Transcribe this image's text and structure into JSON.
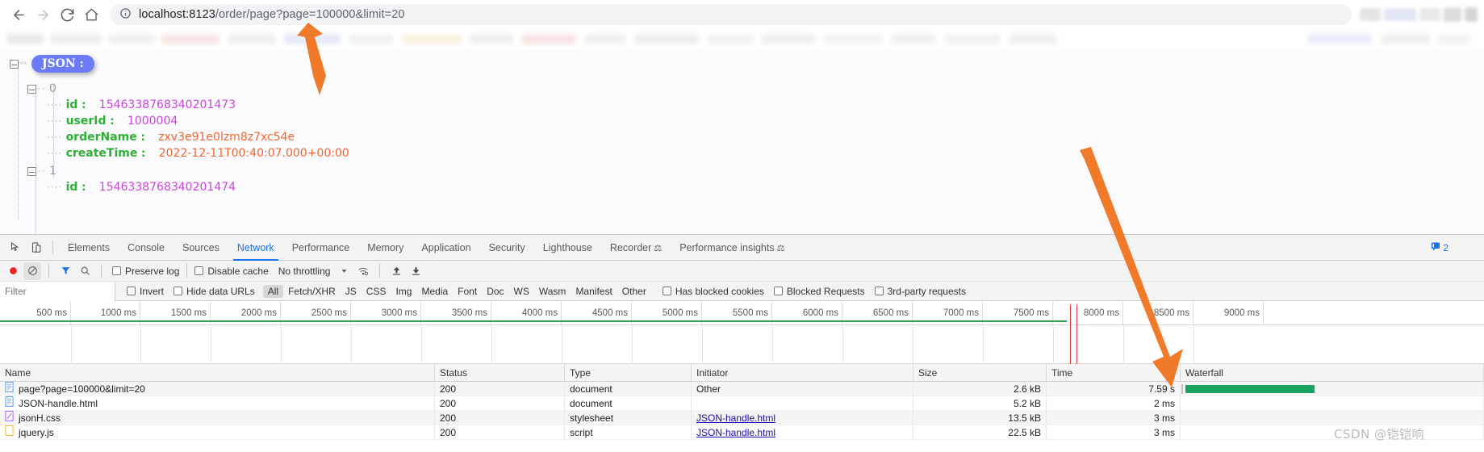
{
  "browser": {
    "back_label": "Back",
    "forward_label": "Forward",
    "reload_label": "Reload",
    "home_label": "Home",
    "site_info_icon": "info-circle-icon",
    "url_host": "localhost:8123",
    "url_path": "/order/page?page=100000&limit=20",
    "url_full": "localhost:8123/order/page?page=100000&limit=20"
  },
  "json_viewer": {
    "root_label": "JSON :",
    "nodes": [
      {
        "index": "0",
        "fields": [
          {
            "key": "id",
            "value": "1546338768340201473",
            "vtype": "num"
          },
          {
            "key": "userId",
            "value": "1000004",
            "vtype": "num"
          },
          {
            "key": "orderName",
            "value": "zxv3e91e0lzm8z7xc54e",
            "vtype": "str"
          },
          {
            "key": "createTime",
            "value": "2022-12-11T00:40:07.000+00:00",
            "vtype": "str"
          }
        ]
      },
      {
        "index": "1",
        "fields": [
          {
            "key": "id",
            "value": "1546338768340201474",
            "vtype": "num"
          }
        ]
      }
    ],
    "colors": {
      "key": "#2faf35",
      "number": "#cc44dd",
      "string": "#ef6632",
      "badge": "#6c7bf7"
    }
  },
  "devtools": {
    "tabs": [
      {
        "label": "Elements",
        "active": false
      },
      {
        "label": "Console",
        "active": false
      },
      {
        "label": "Sources",
        "active": false
      },
      {
        "label": "Network",
        "active": true
      },
      {
        "label": "Performance",
        "active": false
      },
      {
        "label": "Memory",
        "active": false
      },
      {
        "label": "Application",
        "active": false
      },
      {
        "label": "Security",
        "active": false
      },
      {
        "label": "Lighthouse",
        "active": false
      },
      {
        "label": "Recorder",
        "active": false,
        "beaker": true
      },
      {
        "label": "Performance insights",
        "active": false,
        "beaker": true
      }
    ],
    "inspect_icon": "inspect-element-icon",
    "device_icon": "device-toolbar-icon",
    "messages_count": "2",
    "messages_icon": "message-icon",
    "toolbar": {
      "record_icon": "record-stop-icon",
      "clear_icon": "clear-icon",
      "filter_icon": "filter-funnel-icon",
      "search_icon": "search-icon",
      "preserve_log": "Preserve log",
      "disable_cache": "Disable cache",
      "throttling": "No throttling",
      "throttle_caret_icon": "chevron-down-icon",
      "network_conditions_icon": "wifi-settings-icon",
      "import_icon": "import-har-icon",
      "export_icon": "export-har-icon"
    },
    "filterbar": {
      "filter_placeholder": "Filter",
      "filter_value": "",
      "invert": "Invert",
      "hide_data_urls": "Hide data URLs",
      "types": [
        "All",
        "Fetch/XHR",
        "JS",
        "CSS",
        "Img",
        "Media",
        "Font",
        "Doc",
        "WS",
        "Wasm",
        "Manifest",
        "Other"
      ],
      "active_type": "All",
      "has_blocked_cookies": "Has blocked cookies",
      "blocked_requests": "Blocked Requests",
      "third_party_requests": "3rd-party requests"
    },
    "overview_ticks": [
      "500 ms",
      "1000 ms",
      "1500 ms",
      "2000 ms",
      "2500 ms",
      "3000 ms",
      "3500 ms",
      "4000 ms",
      "4500 ms",
      "5000 ms",
      "5500 ms",
      "6000 ms",
      "6500 ms",
      "7000 ms",
      "7500 ms",
      "8000 ms",
      "8500 ms",
      "9000 ms"
    ],
    "table": {
      "columns": [
        "Name",
        "Status",
        "Type",
        "Initiator",
        "Size",
        "Time",
        "Waterfall"
      ],
      "rows": [
        {
          "icon": "document-file-icon",
          "name": "page?page=100000&limit=20",
          "status": "200",
          "type": "document",
          "initiator": "Other",
          "initiator_link": false,
          "size": "2.6 kB",
          "time": "7.59 s",
          "waterfall": true
        },
        {
          "icon": "document-file-icon",
          "name": "JSON-handle.html",
          "status": "200",
          "type": "document",
          "initiator": "",
          "initiator_link": false,
          "size": "5.2 kB",
          "time": "2 ms",
          "waterfall": false
        },
        {
          "icon": "stylesheet-file-icon",
          "name": "jsonH.css",
          "status": "200",
          "type": "stylesheet",
          "initiator": "JSON-handle.html",
          "initiator_link": true,
          "size": "13.5 kB",
          "time": "3 ms",
          "waterfall": false
        },
        {
          "icon": "script-file-icon",
          "name": "jquery.js",
          "status": "200",
          "type": "script",
          "initiator": "JSON-handle.html",
          "initiator_link": true,
          "size": "22.5 kB",
          "time": "3 ms",
          "waterfall": false
        }
      ]
    }
  },
  "watermark": "CSDN @铠铠响",
  "annotations": {
    "arrow_top": "arrow-pointing-to-url",
    "arrow_bottom": "arrow-pointing-to-time-column"
  }
}
